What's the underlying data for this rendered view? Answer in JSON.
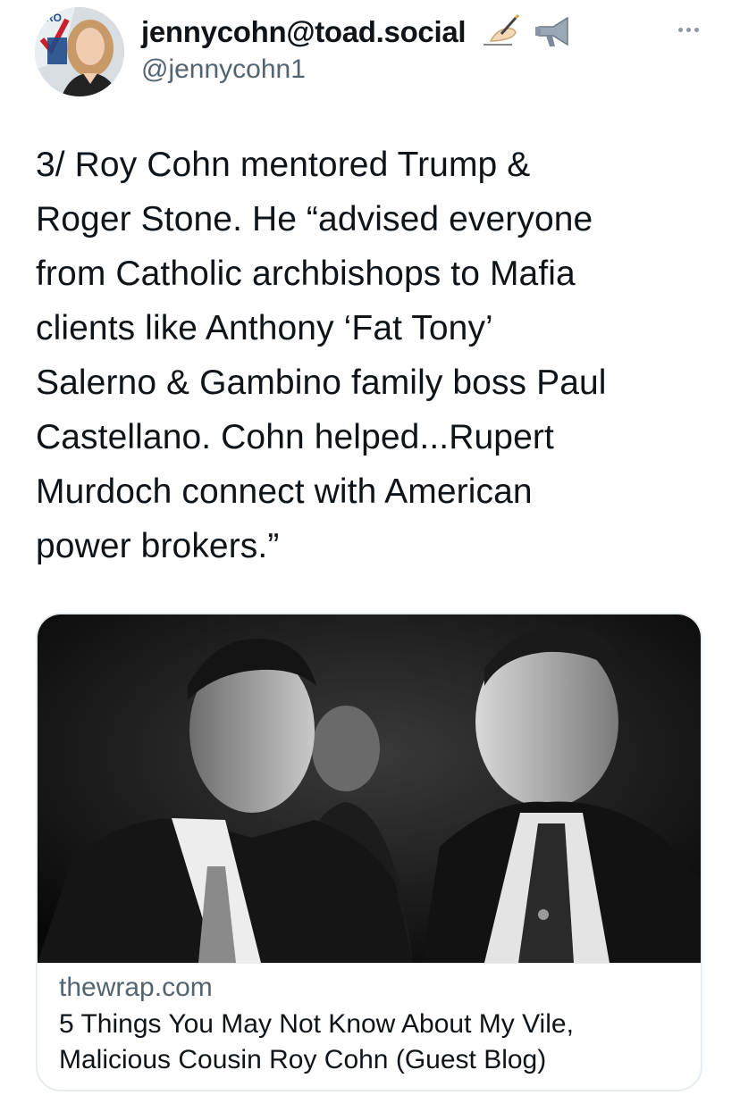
{
  "author": {
    "display_name": "jennycohn@toad.social",
    "handle": "@jennycohn1",
    "name_icons": [
      "writing-hand-icon",
      "megaphone-icon"
    ],
    "avatar_badge_text": "PRO"
  },
  "tweet": {
    "text": "3/ Roy Cohn mentored Trump &\nRoger Stone. He “advised everyone\nfrom Catholic archbishops to Mafia\nclients like Anthony ‘Fat Tony’\nSalerno & Gambino family boss Paul\nCastellano. Cohn helped...Rupert\nMurdoch connect with American\npower brokers.”"
  },
  "link_card": {
    "image": "black-and-white-photo-two-men-in-suits",
    "domain": "thewrap.com",
    "title": "5 Things You May Not Know About My Vile,\nMalicious Cousin Roy Cohn (Guest Blog)"
  },
  "colors": {
    "text": "#0f1419",
    "secondary": "#536471",
    "border": "#e6ecf0"
  }
}
